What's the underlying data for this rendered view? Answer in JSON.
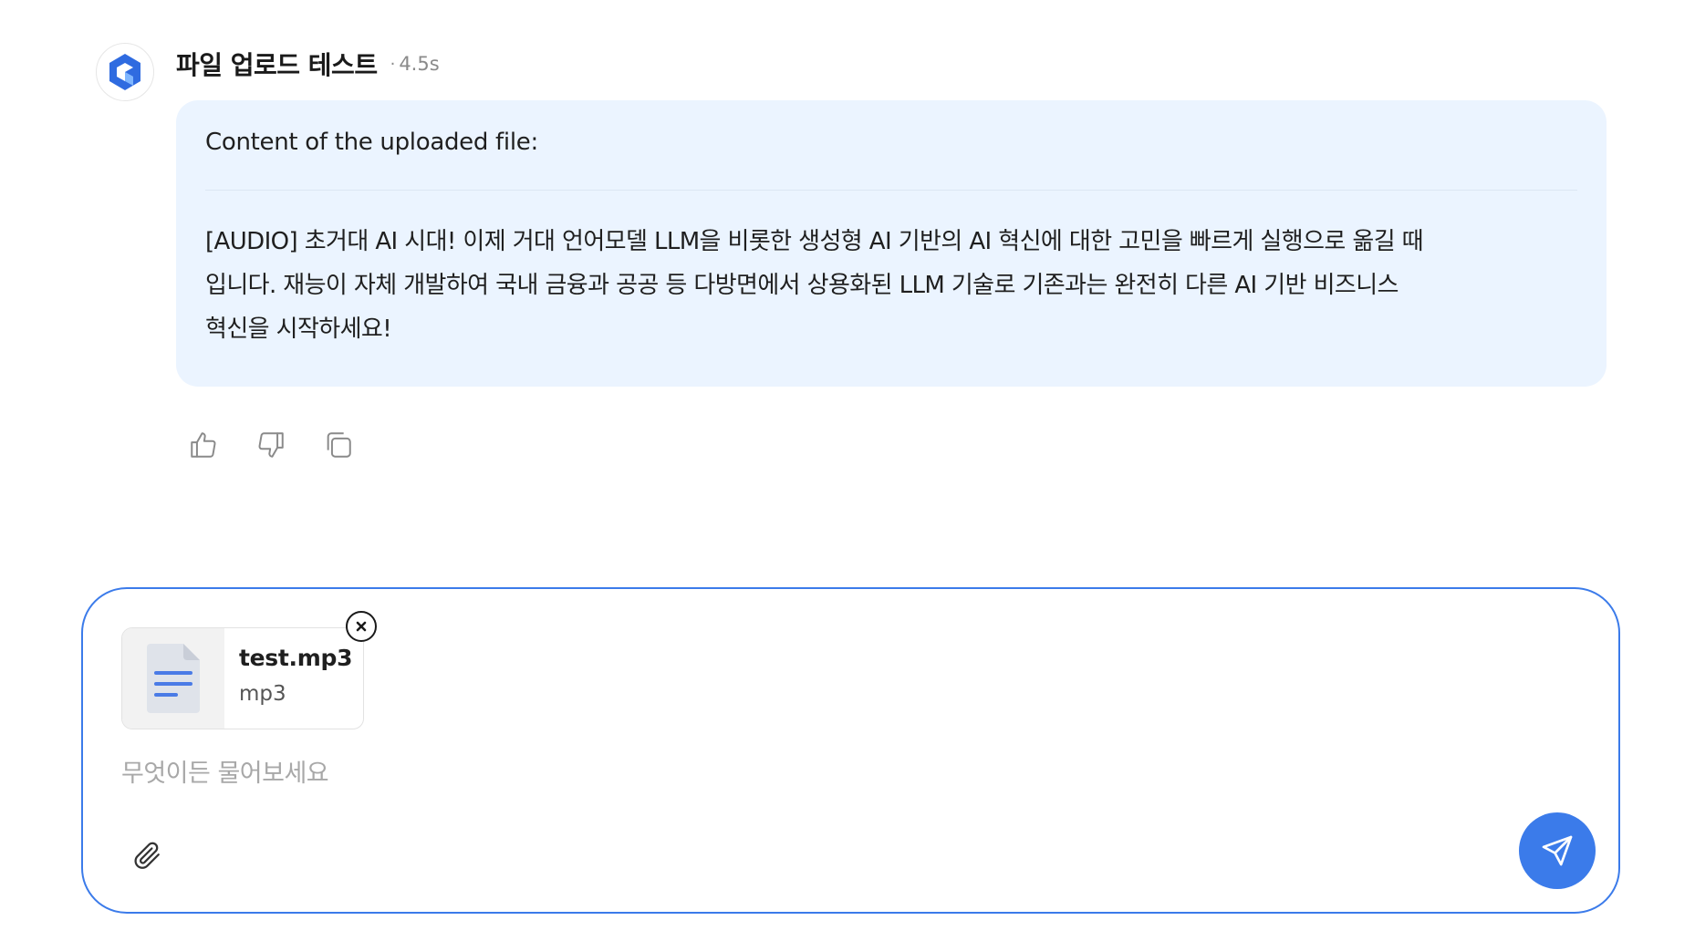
{
  "message": {
    "bot_avatar_icon": "brand-logo-icon",
    "title": "파일 업로드 테스트",
    "response_time": "4.5s",
    "bubble_bg": "#ebf4ff",
    "intro": "Content of the uploaded file:",
    "body_lines": [
      "[AUDIO] 초거대 AI 시대! 이제 거대 언어모델 LLM을 비롯한 생성형 AI 기반의 AI 혁신에 대한 고민을 빠르게 실행으로 옮길 때",
      "입니다. 재능이 자체 개발하여 국내 금융과 공공 등 다방면에서 상용화된 LLM 기술로 기존과는 완전히 다른 AI 기반 비즈니스",
      "혁신을 시작하세요!"
    ]
  },
  "actions": [
    {
      "icon": "thumbs-up-icon"
    },
    {
      "icon": "thumbs-down-icon"
    },
    {
      "icon": "copy-icon"
    }
  ],
  "composer": {
    "border_color": "#3b7bea",
    "attachment": {
      "file_name": "test.mp3",
      "file_type": "mp3",
      "thumb_icon": "document-icon",
      "remove_icon": "close-icon"
    },
    "placeholder": "무엇이든 물어보세요",
    "value": "",
    "attach_icon": "paperclip-icon",
    "send_icon": "send-icon",
    "send_color": "#3b7bea"
  }
}
